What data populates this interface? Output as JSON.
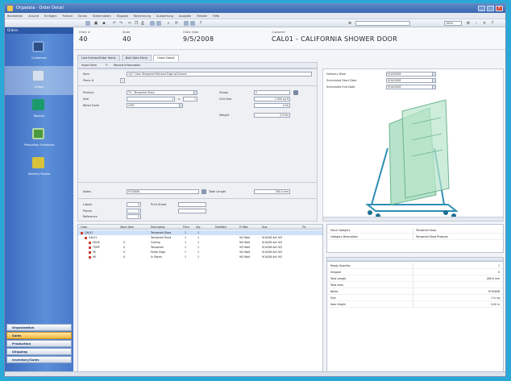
{
  "window": {
    "title": "Orgadata - Order Detail"
  },
  "menu": [
    "Bearbeiten",
    "Ansicht",
    "Einfügen",
    "Format",
    "Extras",
    "Stammdaten",
    "Eingabe",
    "Berechnung",
    "Auswertung",
    "Ausgabe",
    "Fenster",
    "Hilfe"
  ],
  "toolbar": {
    "zoom_value": "100%"
  },
  "nav": {
    "header": "Orders",
    "items": [
      {
        "label": "Customers",
        "color": "#2e4f86"
      },
      {
        "label": "Orders",
        "color": "#cfd9ea"
      },
      {
        "label": "Reports",
        "color": "#1d9a6c"
      },
      {
        "label": "Production Schedules",
        "color": "#4c9a3f"
      },
      {
        "label": "Delivery Routes",
        "color": "#d8c23c"
      }
    ],
    "sections": [
      "Organization",
      "Sales",
      "Production",
      "Shipping",
      "Inventory/Sales"
    ]
  },
  "header": {
    "order_label": "Order #",
    "order_value": "40",
    "state_label": "State",
    "state_value": "40",
    "date_label": "Order Date",
    "date_value": "9/5/2008",
    "customer_label": "Customer",
    "customer_value": "CAL01 - CALIFORNIA SHOWER DOOR"
  },
  "tabs": [
    "Line Entries/Order Items",
    "Bulk Data Entry",
    "Order Detail"
  ],
  "subtoolbar": {
    "add": "Insert Item",
    "remove": "Record Information"
  },
  "form": {
    "item_label": "Item",
    "item_value": "1/4\" Clear Tempered Polished Edge w/Corners",
    "piece_label": "Piece #",
    "piece_value": "1",
    "product_label": "Product",
    "product_value": "T4 - Tempered Glass",
    "shape_label": "Shape",
    "shape_value": "0",
    "size_label": "Size",
    "size_w": "1",
    "size_h": "1",
    "uom_label": "Unit Size",
    "uom_value": "2.500 sq ft",
    "charge_label": "Charge",
    "charge_value": "0.00",
    "volume_label": "Billed Code",
    "volume_value": "LFE2",
    "weight_label": "Weight",
    "weight_value": "0.0 lbs",
    "notes_label": "Notes",
    "notes_value": "9742808",
    "length_label": "Total Length",
    "length_value": "280.0 mm",
    "label_label": "Labels",
    "label_value": "0",
    "pieces_label": "Pieces",
    "pieces_value": "0",
    "print_label": "Print Sheet",
    "ref_label": "Reference",
    "ref_value": "0",
    "rooms_label": "Rooms",
    "rooms_value": "10.0"
  },
  "dates": {
    "delivery_label": "Delivery Date",
    "delivery_value": "9/10/2008",
    "sched_label": "Scheduled Start Date",
    "sched_value": "9/10/2008",
    "end_label": "Scheduled End Date",
    "end_value": "9/10/2008"
  },
  "preview": {
    "glass_color": "#9fd9b8",
    "rack_color": "#2c8db5"
  },
  "grid": {
    "columns": [
      "Code",
      "Stock Item",
      "Description",
      "Price",
      "Qty",
      "Modified",
      "Pr Wks",
      "Due",
      "Fin"
    ],
    "rows": [
      {
        "indent": 0,
        "code": "CAL01",
        "stock": "",
        "desc": "Tempered Glass",
        "price": "1",
        "qty": "1",
        "mod": "",
        "wks": "",
        "due": "",
        "fin": "",
        "sel": true
      },
      {
        "indent": 1,
        "code": "CAL01",
        "stock": "",
        "desc": "Tempered Glass",
        "price": "1",
        "qty": "1",
        "mod": "",
        "wks": "9/5 Wait",
        "due": "9/10/08 Ack 9/5",
        "fin": "",
        "sel": false
      },
      {
        "indent": 2,
        "code": "EDGE",
        "stock": "U",
        "desc": "Cutting",
        "price": "1",
        "qty": "1",
        "mod": "",
        "wks": "9/5 Wait",
        "due": "9/10/08 Ack 9/5",
        "fin": "",
        "sel": false
      },
      {
        "indent": 2,
        "code": "TEMP",
        "stock": "U",
        "desc": "Tempered",
        "price": "1",
        "qty": "1",
        "mod": "",
        "wks": "9/5 Wait",
        "due": "9/10/08 Ack 9/5",
        "fin": "",
        "sel": false
      },
      {
        "indent": 2,
        "code": "PE",
        "stock": "U",
        "desc": "Polish Edge",
        "price": "1",
        "qty": "1",
        "mod": "",
        "wks": "9/5 Wait",
        "due": "9/10/08 Ack 9/5",
        "fin": "",
        "sel": false
      },
      {
        "indent": 2,
        "code": "HE",
        "stock": "U",
        "desc": "In Stores",
        "price": "1",
        "qty": "1",
        "mod": "",
        "wks": "9/5 Wait",
        "due": "9/10/08 Ack 9/5",
        "fin": "",
        "sel": false
      }
    ]
  },
  "prop1": [
    {
      "k": "Stock Category",
      "v": "Tempered Glass"
    },
    {
      "k": "Category Description",
      "v": "Tempered Glass Products"
    }
  ],
  "prop2": [
    {
      "k": "Ready Quantity",
      "v": "1"
    },
    {
      "k": "Shipped",
      "v": "0"
    },
    {
      "k": "Total Length",
      "v": "280.0 mm"
    },
    {
      "k": "Total Area",
      "v": ""
    },
    {
      "k": "Notes",
      "v": "9742808"
    },
    {
      "k": "Size",
      "v": "1 in sq"
    },
    {
      "k": "Item Height",
      "v": "0.00 in"
    }
  ]
}
